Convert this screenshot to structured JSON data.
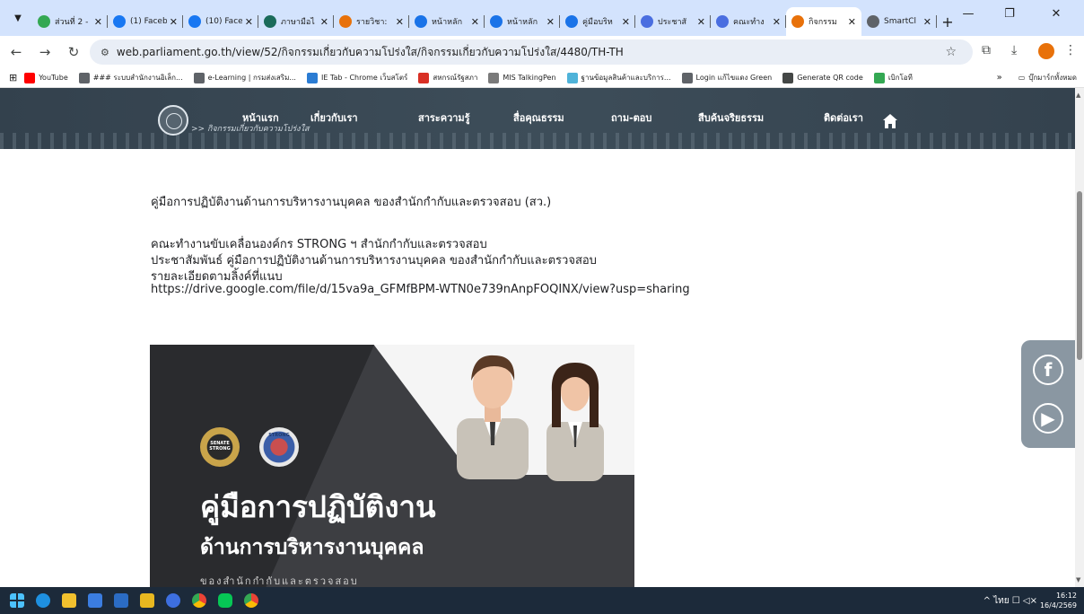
{
  "browser": {
    "tabs": [
      {
        "title": "ส่วนที่ 2 -",
        "favicon_color": "#34a853",
        "active": false
      },
      {
        "title": "(1) Faceb",
        "favicon_color": "#1877f2",
        "active": false
      },
      {
        "title": "(10) Face",
        "favicon_color": "#1877f2",
        "active": false
      },
      {
        "title": "ภาษามือไ",
        "favicon_color": "#1b6b5a",
        "active": false
      },
      {
        "title": "รายวิชา:",
        "favicon_color": "#e8710a",
        "active": false
      },
      {
        "title": "หน้าหลัก",
        "favicon_color": "#1a73e8",
        "active": false
      },
      {
        "title": "หน้าหลัก",
        "favicon_color": "#1a73e8",
        "active": false
      },
      {
        "title": "คู่มือบริห",
        "favicon_color": "#1a73e8",
        "active": false
      },
      {
        "title": "ประชาสั",
        "favicon_color": "#4a6ee0",
        "active": false
      },
      {
        "title": "คณะทำง",
        "favicon_color": "#4a6ee0",
        "active": false
      },
      {
        "title": "กิจกรรม",
        "favicon_color": "#e8710a",
        "active": true
      },
      {
        "title": "SmartCl",
        "favicon_color": "#5f6368",
        "active": false
      }
    ],
    "new_tab_label": "+",
    "url": "web.parliament.go.th/view/52/กิจกรรมเกี่ยวกับความโปร่งใส/กิจกรรมเกี่ยวกับความโปร่งใส/4480/TH-TH",
    "bookmarks": [
      {
        "label": "YouTube",
        "color": "#ff0000"
      },
      {
        "label": "### ระบบสำนักงานอิเล็ก...",
        "color": "#5f6368"
      },
      {
        "label": "e-Learning | กรมส่งเสริม...",
        "color": "#5f6368"
      },
      {
        "label": "IE Tab - Chrome เว็บสโตร์",
        "color": "#2b7cd3"
      },
      {
        "label": "สหกรณ์รัฐสภา",
        "color": "#d93025"
      },
      {
        "label": "MIS TalkingPen",
        "color": "#7a7a7a"
      },
      {
        "label": "ฐานข้อมูลสินค้าและบริการ...",
        "color": "#4fb3d9"
      },
      {
        "label": "Login แก้ไขแดง Green",
        "color": "#5f6368"
      },
      {
        "label": "Generate QR code",
        "color": "#444746"
      },
      {
        "label": "เบิกโอที",
        "color": "#34a853"
      }
    ],
    "bookmarks_more": "»",
    "all_bookmarks": "บุ๊กมาร์กทั้งหมด"
  },
  "site": {
    "menu": [
      "หน้าแรก",
      "เกี่ยวกับเรา",
      "สาระความรู้",
      "สื่อคุณธรรม",
      "ถาม-ตอบ",
      "สืบค้นจริยธรรม",
      "ติดต่อเรา"
    ],
    "breadcrumb": ">> กิจกรรมเกี่ยวกับความโปร่งใส"
  },
  "article": {
    "title": "คู่มือการปฏิบัติงานด้านการบริหารงานบุคคล ของสำนักกำกับและตรวจสอบ (สว.)",
    "lines": [
      "คณะทำงานขับเคลื่อนองค์กร STRONG ฯ สำนักกำกับและตรวจสอบ",
      "ประชาสัมพันธ์ คู่มือการปฏิบัติงานด้านการบริหารงานบุคคล ของสำนักกำกับและตรวจสอบ",
      "รายละเอียดตามลิ้งค์ที่แนบ",
      "https://drive.google.com/file/d/15va9a_GFMfBPM-WTN0e739nAnpFOQINX/view?usp=sharing"
    ]
  },
  "poster": {
    "title": "คู่มือการปฏิบัติงาน",
    "subtitle": "ด้านการบริหารงานบุคคล",
    "small_text": "ของสำนักกำกับและตรวจสอบ",
    "badge_left_text": "SENATE STRONG",
    "badge_right_text": "STRONG"
  },
  "taskbar": {
    "tray_text": "^   ไทย   ☐ ◁×",
    "time": "16:12",
    "date": "16/4/2569"
  }
}
